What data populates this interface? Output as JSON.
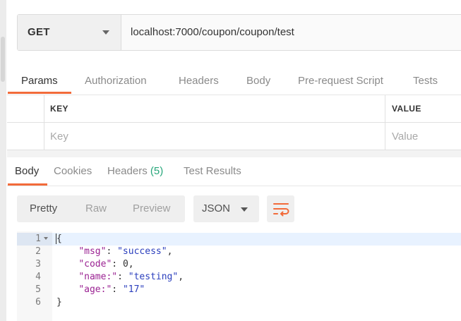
{
  "request": {
    "method": "GET",
    "url": "localhost:7000/coupon/coupon/test"
  },
  "request_tabs": [
    "Params",
    "Authorization",
    "Headers",
    "Body",
    "Pre-request Script",
    "Tests"
  ],
  "params": {
    "key_header": "KEY",
    "value_header": "VALUE",
    "key_placeholder": "Key",
    "value_placeholder": "Value"
  },
  "response_tabs": {
    "body": "Body",
    "cookies": "Cookies",
    "headers": "Headers",
    "headers_count": "(5)",
    "test_results": "Test Results"
  },
  "response_view": {
    "modes": [
      "Pretty",
      "Raw",
      "Preview"
    ],
    "active_mode": "Pretty",
    "format": "JSON",
    "wrap_icon": "wrap-lines-icon"
  },
  "response_body": {
    "line_numbers": [
      "1",
      "2",
      "3",
      "4",
      "5",
      "6"
    ],
    "open_brace": "{",
    "close_brace": "}",
    "fields": [
      {
        "key": "\"msg\"",
        "value": "\"success\"",
        "trail": ","
      },
      {
        "key": "\"code\"",
        "value": "0",
        "trail": ","
      },
      {
        "key": "\"name:\"",
        "value": "\"testing\"",
        "trail": ","
      },
      {
        "key": "\"age:\"",
        "value": "\"17\"",
        "trail": ""
      }
    ]
  },
  "colors": {
    "accent": "#f26b3a",
    "count_green": "#26a67a",
    "json_key": "#9b2393",
    "json_string": "#2b3fbd"
  }
}
